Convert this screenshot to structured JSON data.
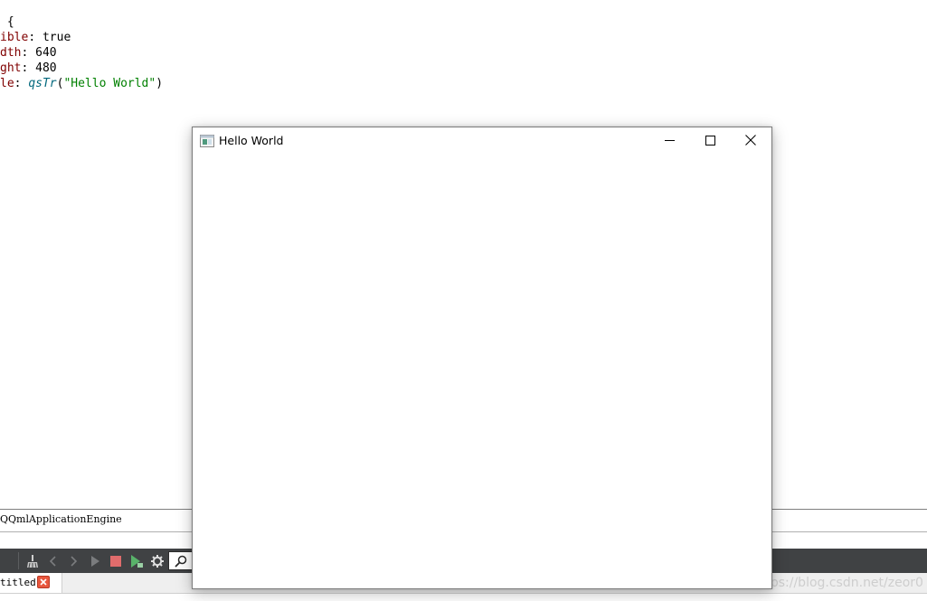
{
  "editor": {
    "lines": [
      {
        "text": " {",
        "parts": []
      },
      {
        "prop": "ible",
        "sep": ": ",
        "value": "true"
      },
      {
        "prop": "dth",
        "sep": ": ",
        "value": "640"
      },
      {
        "prop": "ght",
        "sep": ": ",
        "value": "480"
      },
      {
        "prop": "le",
        "sep": ": ",
        "fn": "qsTr",
        "open": "(",
        "str": "\"Hello World\"",
        "close": ")"
      }
    ]
  },
  "output": {
    "text": "QQmlApplicationEngine"
  },
  "toolbar": {
    "icons": [
      "broom-icon",
      "back-arrow-icon",
      "forward-arrow-icon",
      "play-icon",
      "stop-icon",
      "run-special-icon",
      "gear-icon",
      "search-icon"
    ]
  },
  "tabs": [
    {
      "label": "titled",
      "close_icon": "close-icon"
    }
  ],
  "watermark": "https://blog.csdn.net/zeor0",
  "window": {
    "title": "Hello World",
    "icon": "qt-window-icon",
    "buttons": [
      "minimize-icon",
      "maximize-icon",
      "close-icon"
    ]
  },
  "colors": {
    "toolbar_bg": "#404244",
    "property": "#800000",
    "function": "#00677c",
    "string": "#008000",
    "stop_red": "#e06c6c",
    "run_green": "#59b36a"
  }
}
